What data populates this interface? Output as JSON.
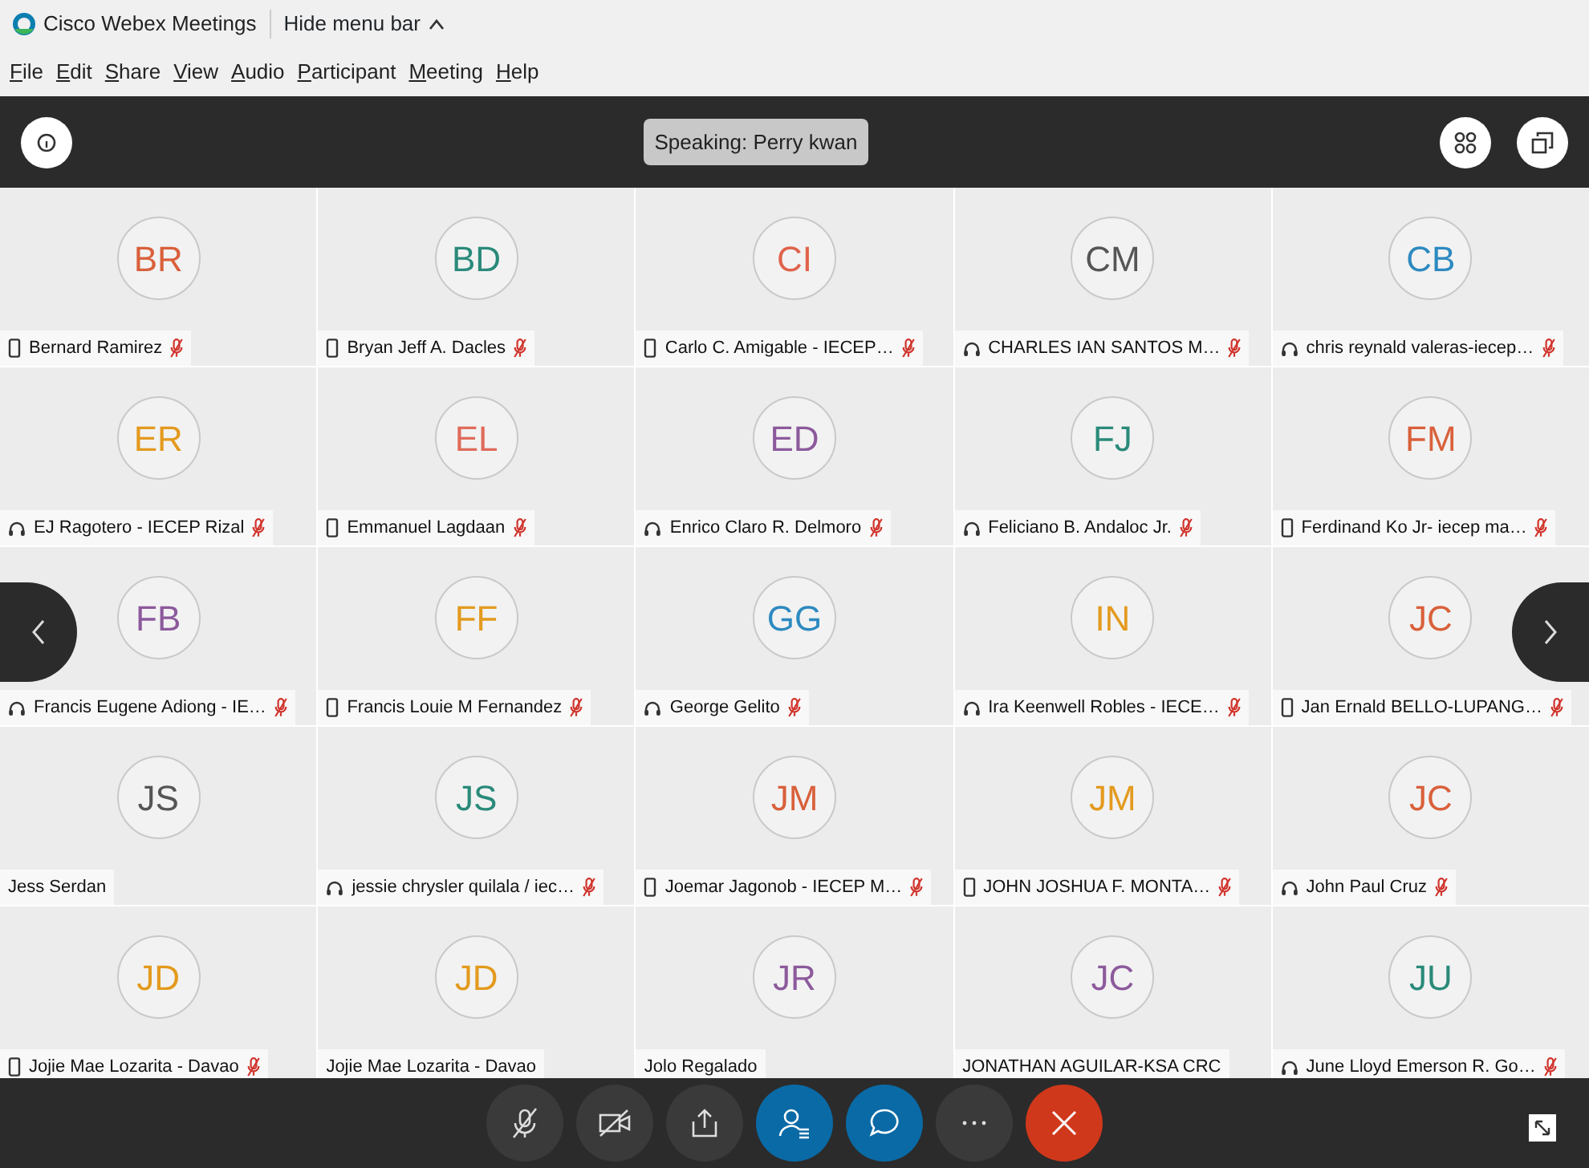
{
  "window": {
    "title": "Cisco Webex Meetings",
    "menu_toggle": "Hide menu bar"
  },
  "menu": [
    "File",
    "Edit",
    "Share",
    "View",
    "Audio",
    "Participant",
    "Meeting",
    "Help"
  ],
  "speaking": "Speaking: Perry kwan",
  "participants": [
    {
      "initials": "BR",
      "name": "Bernard Ramirez",
      "color": "#d9603b",
      "kind": "phone",
      "muted": true
    },
    {
      "initials": "BD",
      "name": "Bryan Jeff A. Dacles",
      "color": "#2a8a7a",
      "kind": "phone",
      "muted": true
    },
    {
      "initials": "CI",
      "name": "Carlo C. Amigable - IECEP…",
      "color": "#e0624a",
      "kind": "phone",
      "muted": true
    },
    {
      "initials": "CM",
      "name": "CHARLES IAN SANTOS M…",
      "color": "#555555",
      "kind": "headset",
      "muted": true
    },
    {
      "initials": "CB",
      "name": "chris reynald valeras-iecep…",
      "color": "#2d8ac0",
      "kind": "headset",
      "muted": true
    },
    {
      "initials": "ER",
      "name": "EJ Ragotero - IECEP Rizal",
      "color": "#e39a1e",
      "kind": "headset",
      "muted": true
    },
    {
      "initials": "EL",
      "name": "Emmanuel Lagdaan",
      "color": "#e06b5a",
      "kind": "phone",
      "muted": true
    },
    {
      "initials": "ED",
      "name": "Enrico Claro R. Delmoro",
      "color": "#8c5a9c",
      "kind": "headset",
      "muted": true
    },
    {
      "initials": "FJ",
      "name": "Feliciano B. Andaloc Jr.",
      "color": "#2a8a7a",
      "kind": "headset",
      "muted": true
    },
    {
      "initials": "FM",
      "name": "Ferdinand Ko Jr- iecep ma…",
      "color": "#d9603b",
      "kind": "phone",
      "muted": true
    },
    {
      "initials": "FB",
      "name": "Francis Eugene Adiong - IE…",
      "color": "#8c5a9c",
      "kind": "headset",
      "muted": true
    },
    {
      "initials": "FF",
      "name": "Francis Louie M Fernandez",
      "color": "#e39a1e",
      "kind": "phone",
      "muted": true
    },
    {
      "initials": "GG",
      "name": "George Gelito",
      "color": "#2d8ac0",
      "kind": "headset",
      "muted": true
    },
    {
      "initials": "IN",
      "name": "Ira Keenwell Robles - IECE…",
      "color": "#e39a1e",
      "kind": "headset",
      "muted": true
    },
    {
      "initials": "JC",
      "name": "Jan Ernald BELLO-LUPANG…",
      "color": "#d9603b",
      "kind": "phone",
      "muted": true
    },
    {
      "initials": "JS",
      "name": "Jess Serdan",
      "color": "#555555",
      "muted": false
    },
    {
      "initials": "JS",
      "name": "jessie chrysler quilala / iec…",
      "color": "#2a8a7a",
      "kind": "headset",
      "muted": true
    },
    {
      "initials": "JM",
      "name": "Joemar Jagonob - IECEP M…",
      "color": "#d9603b",
      "kind": "phone",
      "muted": true
    },
    {
      "initials": "JM",
      "name": "JOHN JOSHUA F. MONTA…",
      "color": "#e39a1e",
      "kind": "phone",
      "muted": true
    },
    {
      "initials": "JC",
      "name": "John Paul Cruz",
      "color": "#d9603b",
      "kind": "headset",
      "muted": true
    },
    {
      "initials": "JD",
      "name": "Jojie Mae Lozarita - Davao",
      "color": "#e39a1e",
      "kind": "phone",
      "muted": true
    },
    {
      "initials": "JD",
      "name": "Jojie Mae Lozarita - Davao",
      "color": "#e39a1e",
      "muted": false
    },
    {
      "initials": "JR",
      "name": "Jolo Regalado",
      "color": "#8c5a9c",
      "muted": false
    },
    {
      "initials": "JC",
      "name": "JONATHAN AGUILAR-KSA CRC",
      "color": "#8c5a9c",
      "muted": false
    },
    {
      "initials": "JU",
      "name": "June Lloyd Emerson R. Go…",
      "color": "#2a8a7a",
      "kind": "headset",
      "muted": true
    }
  ]
}
